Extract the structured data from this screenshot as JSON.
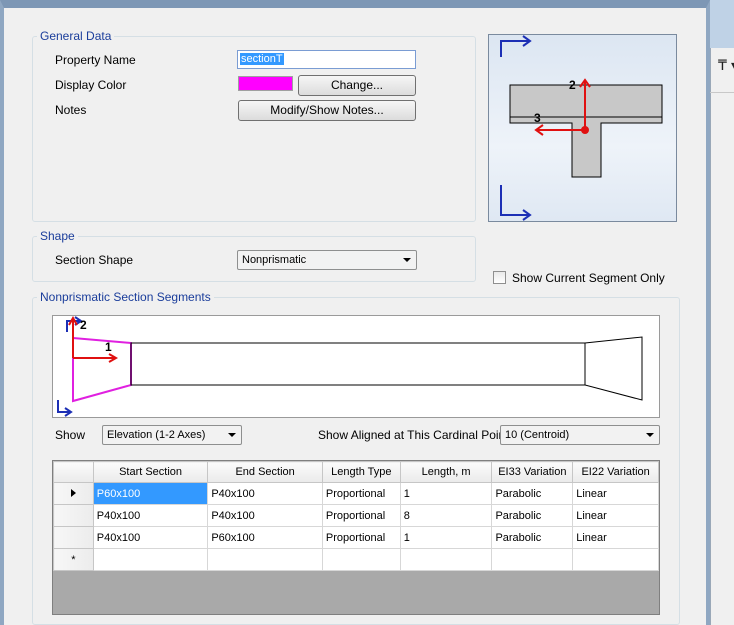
{
  "general": {
    "title": "General Data",
    "property_name_label": "Property Name",
    "property_name_value": "sectionT",
    "display_color_label": "Display Color",
    "display_color": "#ff00ff",
    "change_button": "Change...",
    "notes_label": "Notes",
    "notes_button": "Modify/Show Notes..."
  },
  "shape": {
    "title": "Shape",
    "section_shape_label": "Section Shape",
    "section_shape_value": "Nonprismatic"
  },
  "show_current_segment_only": "Show Current Segment Only",
  "preview": {
    "axis2_label": "2",
    "axis3_label": "3"
  },
  "segments": {
    "title": "Nonprismatic Section Segments",
    "elev_axis2_label": "2",
    "elev_axis1_label": "1",
    "show_label": "Show",
    "show_value": "Elevation (1-2 Axes)",
    "cardinal_label": "Show Aligned at This Cardinal Point",
    "cardinal_value": "10  (Centroid)",
    "columns": [
      "Start Section",
      "End Section",
      "Length Type",
      "Length, m",
      "EI33 Variation",
      "EI22 Variation"
    ],
    "rows": [
      [
        "P60x100",
        "P40x100",
        "Proportional",
        "1",
        "Parabolic",
        "Linear"
      ],
      [
        "P40x100",
        "P40x100",
        "Proportional",
        "8",
        "Parabolic",
        "Linear"
      ],
      [
        "P40x100",
        "P60x100",
        "Proportional",
        "1",
        "Parabolic",
        "Linear"
      ]
    ],
    "new_row_marker": "*"
  },
  "colors": {
    "group_title": "#1a3d9b",
    "axis_blue": "#1c2fb5",
    "axis_red": "#e01010",
    "segment_magenta": "#e020e0"
  },
  "icons": [
    "toolbar-icon",
    "chevron-down-icon",
    "row-pointer-icon"
  ]
}
